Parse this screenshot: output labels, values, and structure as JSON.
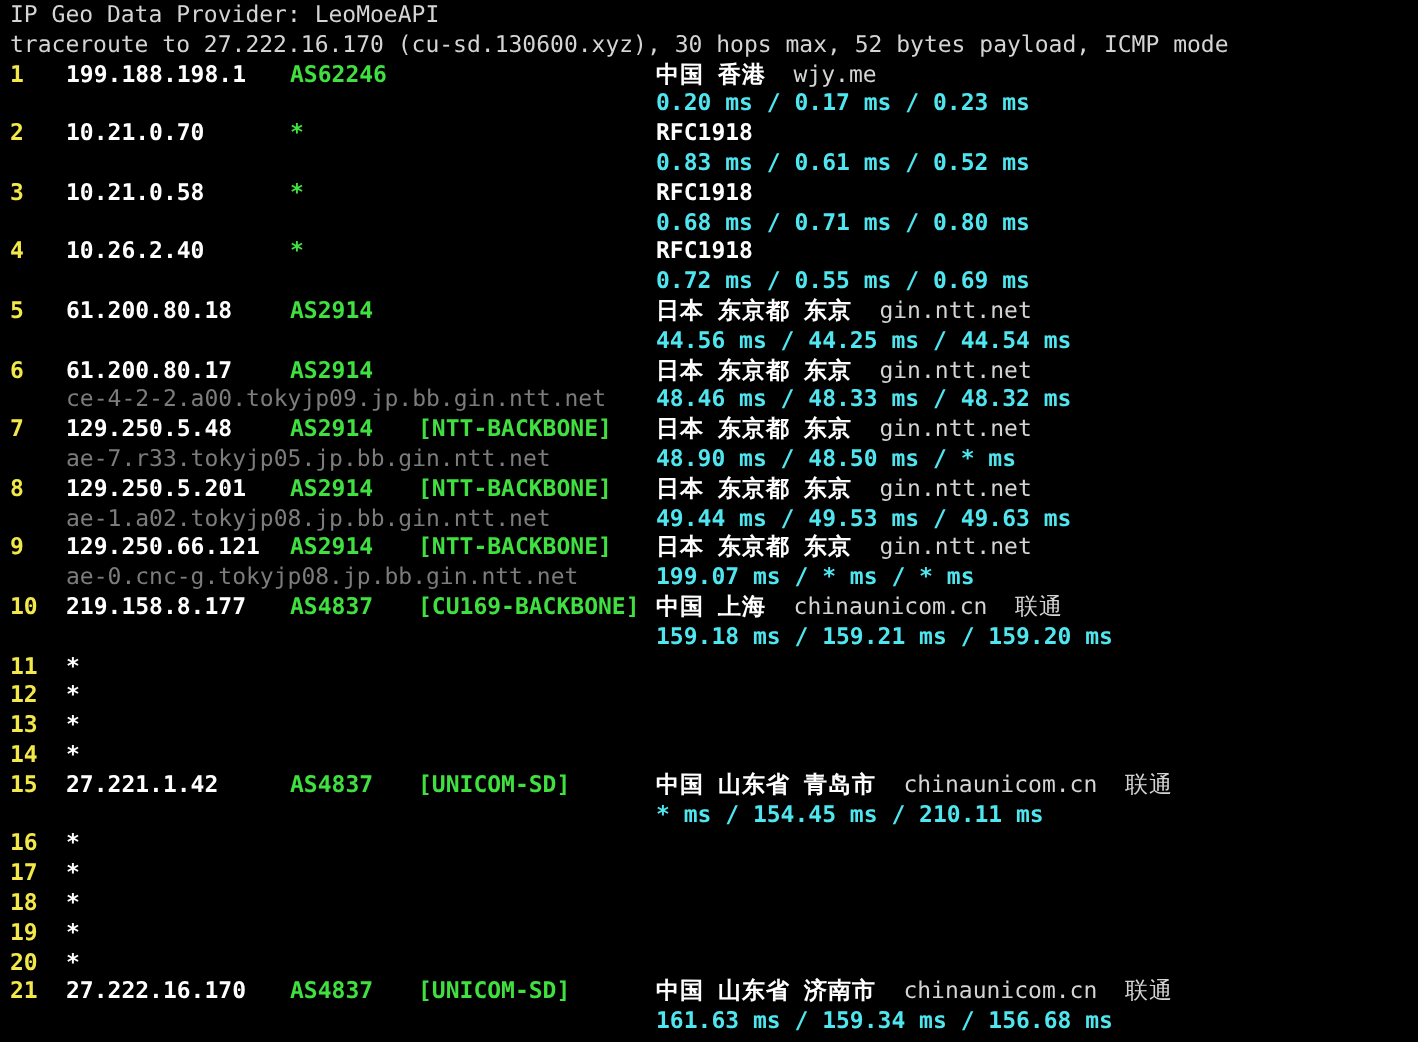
{
  "header": [
    "IP Geo Data Provider: LeoMoeAPI",
    "traceroute to 27.222.16.170 (cu-sd.130600.xyz), 30 hops max, 52 bytes payload, ICMP mode"
  ],
  "hops": [
    {
      "hop": "1",
      "ip": "199.188.198.1",
      "asn": "AS62246",
      "geo": "中国 香港",
      "domain": "wjy.me",
      "rtt": "0.20 ms / 0.17 ms / 0.23 ms"
    },
    {
      "hop": "2",
      "ip": "10.21.0.70",
      "asn": "*",
      "geo": "RFC1918",
      "rtt": "0.83 ms / 0.61 ms / 0.52 ms"
    },
    {
      "hop": "3",
      "ip": "10.21.0.58",
      "asn": "*",
      "geo": "RFC1918",
      "rtt": "0.68 ms / 0.71 ms / 0.80 ms"
    },
    {
      "hop": "4",
      "ip": "10.26.2.40",
      "asn": "*",
      "geo": "RFC1918",
      "rtt": "0.72 ms / 0.55 ms / 0.69 ms"
    },
    {
      "hop": "5",
      "ip": "61.200.80.18",
      "asn": "AS2914",
      "geo": "日本 东京都 东京",
      "domain": "gin.ntt.net",
      "rtt": "44.56 ms / 44.25 ms / 44.54 ms"
    },
    {
      "hop": "6",
      "ip": "61.200.80.17",
      "asn": "AS2914",
      "geo": "日本 东京都 东京",
      "domain": "gin.ntt.net",
      "hostname": "ce-4-2-2.a00.tokyjp09.jp.bb.gin.ntt.net",
      "rtt": "48.46 ms / 48.33 ms / 48.32 ms"
    },
    {
      "hop": "7",
      "ip": "129.250.5.48",
      "asn": "AS2914",
      "tag": "[NTT-BACKBONE]",
      "geo": "日本 东京都 东京",
      "domain": "gin.ntt.net",
      "hostname": "ae-7.r33.tokyjp05.jp.bb.gin.ntt.net",
      "rtt": "48.90 ms / 48.50 ms / * ms"
    },
    {
      "hop": "8",
      "ip": "129.250.5.201",
      "asn": "AS2914",
      "tag": "[NTT-BACKBONE]",
      "geo": "日本 东京都 东京",
      "domain": "gin.ntt.net",
      "hostname": "ae-1.a02.tokyjp08.jp.bb.gin.ntt.net",
      "rtt": "49.44 ms / 49.53 ms / 49.63 ms"
    },
    {
      "hop": "9",
      "ip": "129.250.66.121",
      "asn": "AS2914",
      "tag": "[NTT-BACKBONE]",
      "geo": "日本 东京都 东京",
      "domain": "gin.ntt.net",
      "hostname": "ae-0.cnc-g.tokyjp08.jp.bb.gin.ntt.net",
      "rtt": "199.07 ms / * ms / * ms"
    },
    {
      "hop": "10",
      "ip": "219.158.8.177",
      "asn": "AS4837",
      "tag": "[CU169-BACKBONE]",
      "geo": "中国 上海",
      "domain": "chinaunicom.cn",
      "isp": "联通",
      "rtt": "159.18 ms / 159.21 ms / 159.20 ms"
    },
    {
      "hop": "11",
      "ip": "*"
    },
    {
      "hop": "12",
      "ip": "*"
    },
    {
      "hop": "13",
      "ip": "*"
    },
    {
      "hop": "14",
      "ip": "*"
    },
    {
      "hop": "15",
      "ip": "27.221.1.42",
      "asn": "AS4837",
      "tag": "[UNICOM-SD]",
      "geo": "中国 山东省 青岛市",
      "domain": "chinaunicom.cn",
      "isp": "联通",
      "rtt": "* ms / 154.45 ms / 210.11 ms"
    },
    {
      "hop": "16",
      "ip": "*"
    },
    {
      "hop": "17",
      "ip": "*"
    },
    {
      "hop": "18",
      "ip": "*"
    },
    {
      "hop": "19",
      "ip": "*"
    },
    {
      "hop": "20",
      "ip": "*"
    },
    {
      "hop": "21",
      "ip": "27.222.16.170",
      "asn": "AS4837",
      "tag": "[UNICOM-SD]",
      "geo": "中国 山东省 济南市",
      "domain": "chinaunicom.cn",
      "isp": "联通",
      "rtt": "161.63 ms / 159.34 ms / 156.68 ms"
    }
  ]
}
